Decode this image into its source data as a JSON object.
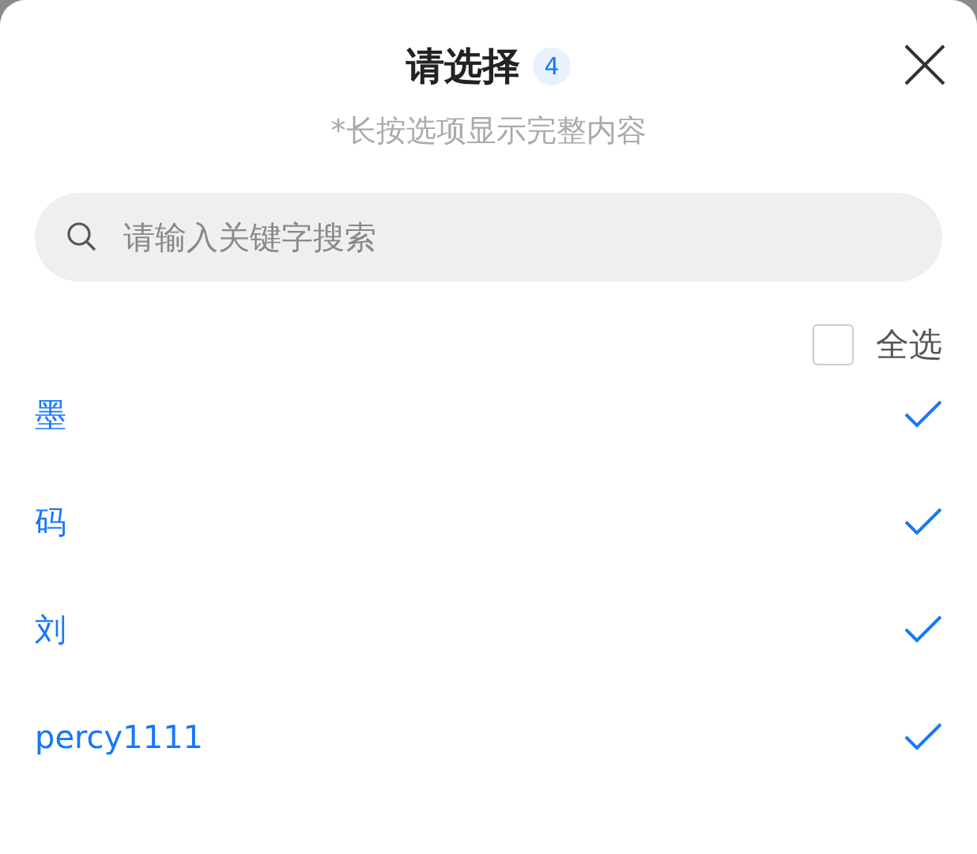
{
  "sheet": {
    "title": "请选择",
    "count": "4",
    "hint": "*长按选项显示完整内容"
  },
  "search": {
    "placeholder": "请输入关键字搜索"
  },
  "select_all": {
    "label": "全选",
    "checked": false
  },
  "options": [
    {
      "label": "墨",
      "selected": true
    },
    {
      "label": "码",
      "selected": true
    },
    {
      "label": "刘",
      "selected": true
    },
    {
      "label": "percy1111",
      "selected": true
    }
  ]
}
